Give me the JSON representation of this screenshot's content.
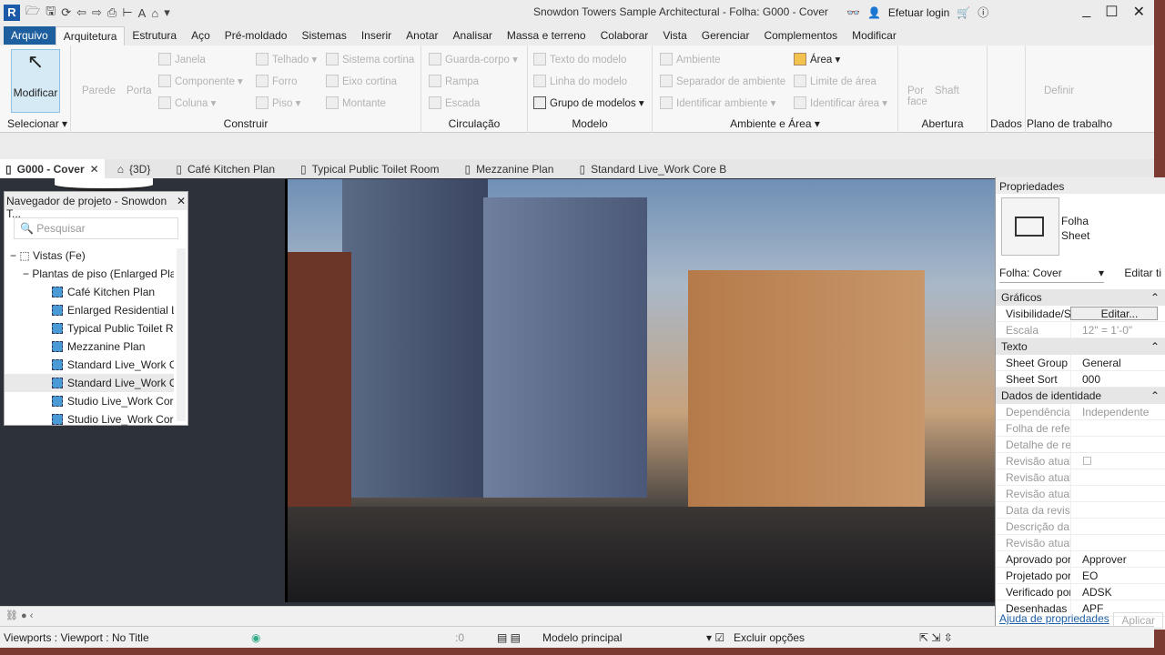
{
  "app": {
    "title": "Snowdon Towers Sample Architectural - Folha: G000 - Cover",
    "login": "Efetuar login",
    "logo": "R"
  },
  "quick_access": [
    "open-icon",
    "save-icon",
    "sync-icon",
    "undo-icon",
    "redo-icon",
    "print-icon",
    "measure-icon",
    "text-icon",
    "home-icon"
  ],
  "ribbon_tabs": [
    "Arquivo",
    "Arquitetura",
    "Estrutura",
    "Aço",
    "Pré-moldado",
    "Sistemas",
    "Inserir",
    "Anotar",
    "Analisar",
    "Massa e terreno",
    "Colaborar",
    "Vista",
    "Gerenciar",
    "Complementos",
    "Modificar"
  ],
  "ribbon": {
    "selecionar": {
      "button": "Modificar",
      "label": "Selecionar"
    },
    "construir": {
      "label": "Construir",
      "items": [
        "Parede",
        "Porta",
        "Janela",
        "Componente",
        "Coluna",
        "Telhado",
        "Forro",
        "Piso",
        "Sistema cortina",
        "Eixo cortina",
        "Montante"
      ]
    },
    "circulacao": {
      "label": "Circulação",
      "items": [
        "Guarda-corpo",
        "Rampa",
        "Escada"
      ]
    },
    "modelo": {
      "label": "Modelo",
      "items": [
        "Texto do modelo",
        "Linha do modelo",
        "Grupo de modelos"
      ]
    },
    "ambiente": {
      "label": "Ambiente e Área",
      "items": [
        "Ambiente",
        "Separador de ambiente",
        "Identificar ambiente",
        "Área",
        "Limite de área",
        "Identificar área"
      ]
    },
    "abertura": {
      "label": "Abertura",
      "items": [
        "Por face",
        "Shaft"
      ]
    },
    "dados": {
      "label": "Dados"
    },
    "plano": {
      "label": "Plano de trabalho",
      "items": [
        "Definir"
      ]
    }
  },
  "view_tabs": [
    "G000 - Cover",
    "{3D}",
    "Café Kitchen Plan",
    "Typical Public Toilet Room",
    "Mezzanine Plan",
    "Standard Live_Work Core B"
  ],
  "browser": {
    "title": "Navegador de projeto - Snowdon T...",
    "search_placeholder": "Pesquisar",
    "root": "Vistas (Fe)",
    "group": "Plantas de piso (Enlarged Plan",
    "items": [
      "Café Kitchen Plan",
      "Enlarged Residential Lo",
      "Typical Public Toilet Ro",
      "Mezzanine Plan",
      "Standard Live_Work Co",
      "Standard Live_Work Co",
      "Studio Live_Work Core",
      "Studio Live_Work Core"
    ]
  },
  "properties": {
    "title": "Propriedades",
    "type_line1": "Folha",
    "type_line2": "Sheet",
    "selector": "Folha: Cover",
    "edit_type": "Editar ti",
    "sections": [
      {
        "name": "Gráficos",
        "rows": [
          {
            "k": "Visibilidade/S...",
            "v": "Editar...",
            "button": true
          },
          {
            "k": "Escala",
            "v": "12\" = 1'-0\"",
            "dim": true
          }
        ]
      },
      {
        "name": "Texto",
        "rows": [
          {
            "k": "Sheet Group",
            "v": "General"
          },
          {
            "k": "Sheet Sort",
            "v": "000"
          }
        ]
      },
      {
        "name": "Dados de identidade",
        "rows": [
          {
            "k": "Dependência",
            "v": "Independente",
            "dim": true
          },
          {
            "k": "Folha de refer...",
            "v": "",
            "dim": true
          },
          {
            "k": "Detalhe de ref...",
            "v": "",
            "dim": true
          },
          {
            "k": "Revisão atual ...",
            "v": "☐",
            "dim": true
          },
          {
            "k": "Revisão atual ...",
            "v": "",
            "dim": true
          },
          {
            "k": "Revisão atual ...",
            "v": "",
            "dim": true
          },
          {
            "k": "Data da revisã...",
            "v": "",
            "dim": true
          },
          {
            "k": "Descrição da r...",
            "v": "",
            "dim": true
          },
          {
            "k": "Revisão atual",
            "v": "",
            "dim": true
          },
          {
            "k": "Aprovado por",
            "v": "Approver"
          },
          {
            "k": "Projetado por",
            "v": "EO"
          },
          {
            "k": "Verificado por",
            "v": "ADSK"
          },
          {
            "k": "Desenhadas por",
            "v": "APF"
          }
        ]
      }
    ],
    "help": "Ajuda de propriedades",
    "apply": "Aplicar"
  },
  "status": {
    "left": "Viewports : Viewport : No Title",
    "count": ":0",
    "model": "Modelo principal",
    "exclude": "Excluir opções"
  }
}
